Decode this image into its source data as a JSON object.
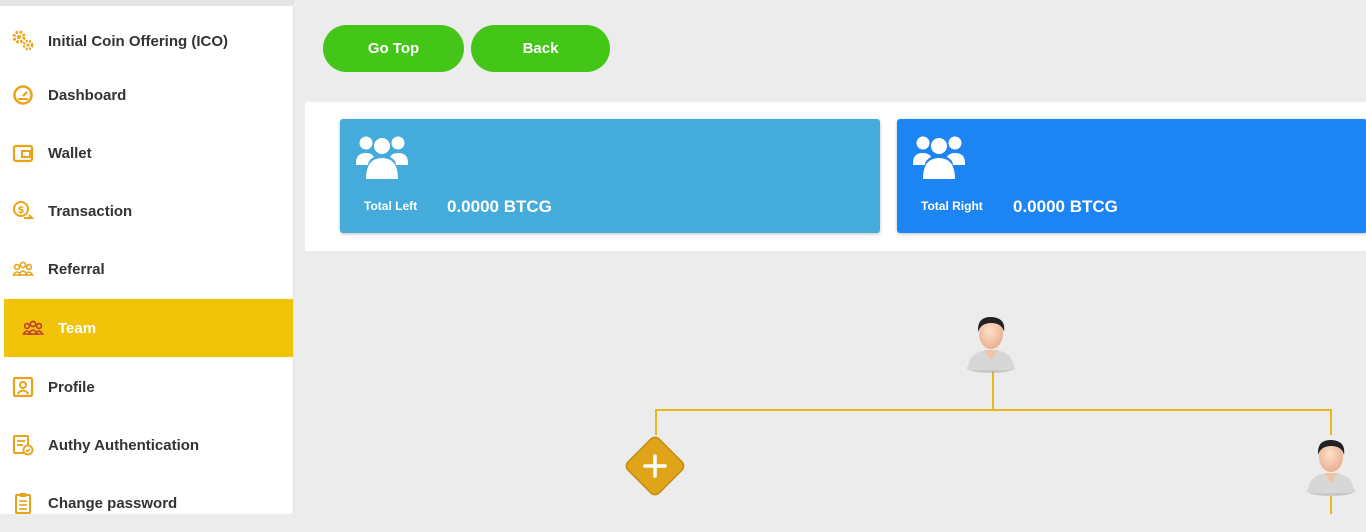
{
  "sidebar": {
    "items": [
      {
        "label": "Initial Coin Offering (ICO)",
        "icon": "coins-gear-icon"
      },
      {
        "label": "Dashboard",
        "icon": "speedometer-icon"
      },
      {
        "label": "Wallet",
        "icon": "wallet-icon"
      },
      {
        "label": "Transaction",
        "icon": "money-transfer-icon"
      },
      {
        "label": "Referral",
        "icon": "people-group-icon"
      },
      {
        "label": "Team",
        "icon": "people-group-icon",
        "active": true
      },
      {
        "label": "Profile",
        "icon": "user-profile-icon"
      },
      {
        "label": "Authy Authentication",
        "icon": "checklist-verified-icon"
      },
      {
        "label": "Change password",
        "icon": "clipboard-icon"
      }
    ]
  },
  "toolbar": {
    "go_top_label": "Go Top",
    "back_label": "Back"
  },
  "stats": {
    "left": {
      "label": "Total Left",
      "value": "0.0000 BTCG",
      "color": "#44abda"
    },
    "right": {
      "label": "Total Right",
      "value": "0.0000 BTCG",
      "color": "#1d84f4"
    }
  },
  "tree": {
    "root": "user-avatar",
    "left_child": "add-member",
    "right_child": "user-avatar",
    "connector_color": "#e9b71a"
  },
  "colors": {
    "accent": "#f1c40a",
    "icon": "#e8a317",
    "button": "#43c618"
  }
}
